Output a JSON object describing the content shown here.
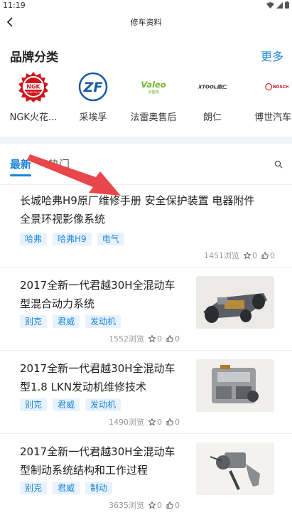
{
  "status_bar": {
    "time": "11:19"
  },
  "nav": {
    "title": "修车资料"
  },
  "brands": {
    "title": "品牌分类",
    "more_label": "更多",
    "items": [
      {
        "name": "NGK火花...",
        "logo": "ngk"
      },
      {
        "name": "采埃孚",
        "logo": "zf"
      },
      {
        "name": "法雷奥售后",
        "logo": "valeo"
      },
      {
        "name": "朗仁",
        "logo": "xtool"
      },
      {
        "name": "博世汽车",
        "logo": "bosch"
      }
    ]
  },
  "tabs": {
    "latest": "最新",
    "hot": "热门"
  },
  "articles": [
    {
      "title_line1": "长城哈弗H9原厂维修手册 安全保护装置 电器附件",
      "title_line2": "全景环视影像系统",
      "tags": [
        "哈弗",
        "哈弗H9",
        "电气"
      ],
      "views": "1451浏览",
      "stars": "0",
      "likes": "0",
      "has_thumb": false
    },
    {
      "title_line1": "2017全新一代君越30H全混动车",
      "title_line2": "型混合动力系统",
      "tags": [
        "别克",
        "君威",
        "发动机"
      ],
      "views": "1552浏览",
      "stars": "0",
      "likes": "0",
      "has_thumb": true
    },
    {
      "title_line1": "2017全新一代君越30H全混动车",
      "title_line2": "型1.8 LKN发动机维修技术",
      "tags": [
        "别克",
        "君威",
        "发动机"
      ],
      "views": "1490浏览",
      "stars": "0",
      "likes": "0",
      "has_thumb": true
    },
    {
      "title_line1": "2017全新一代君越30H全混动车",
      "title_line2": "型制动系统结构和工作过程",
      "tags": [
        "别克",
        "君威",
        "制动"
      ],
      "views": "3635浏览",
      "stars": "0",
      "likes": "0",
      "has_thumb": true
    }
  ],
  "colors": {
    "accent": "#1a86d9",
    "tag_bg": "#e8f2fd",
    "annotation_arrow": "#e8464a"
  }
}
